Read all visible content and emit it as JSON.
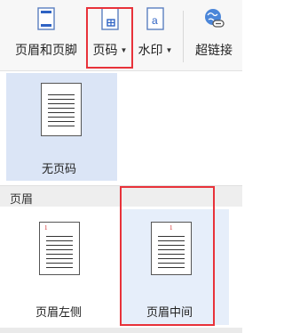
{
  "toolbar": {
    "items": [
      {
        "label": "页眉和页脚",
        "icon": "header-footer-icon"
      },
      {
        "label": "页码",
        "icon": "page-number-icon",
        "dropdown": true
      },
      {
        "label": "水印",
        "icon": "watermark-icon",
        "dropdown": true
      },
      {
        "label": "超链接",
        "icon": "hyperlink-icon"
      }
    ]
  },
  "gallery": {
    "none_label": "无页码",
    "section_title": "页眉",
    "options": [
      {
        "label": "页眉左侧",
        "page_number": "1"
      },
      {
        "label": "页眉中间",
        "page_number": "1"
      }
    ]
  },
  "colors": {
    "highlight": "#e8323a",
    "selected_bg": "#dbe5f6",
    "page_number": "#d02020"
  }
}
